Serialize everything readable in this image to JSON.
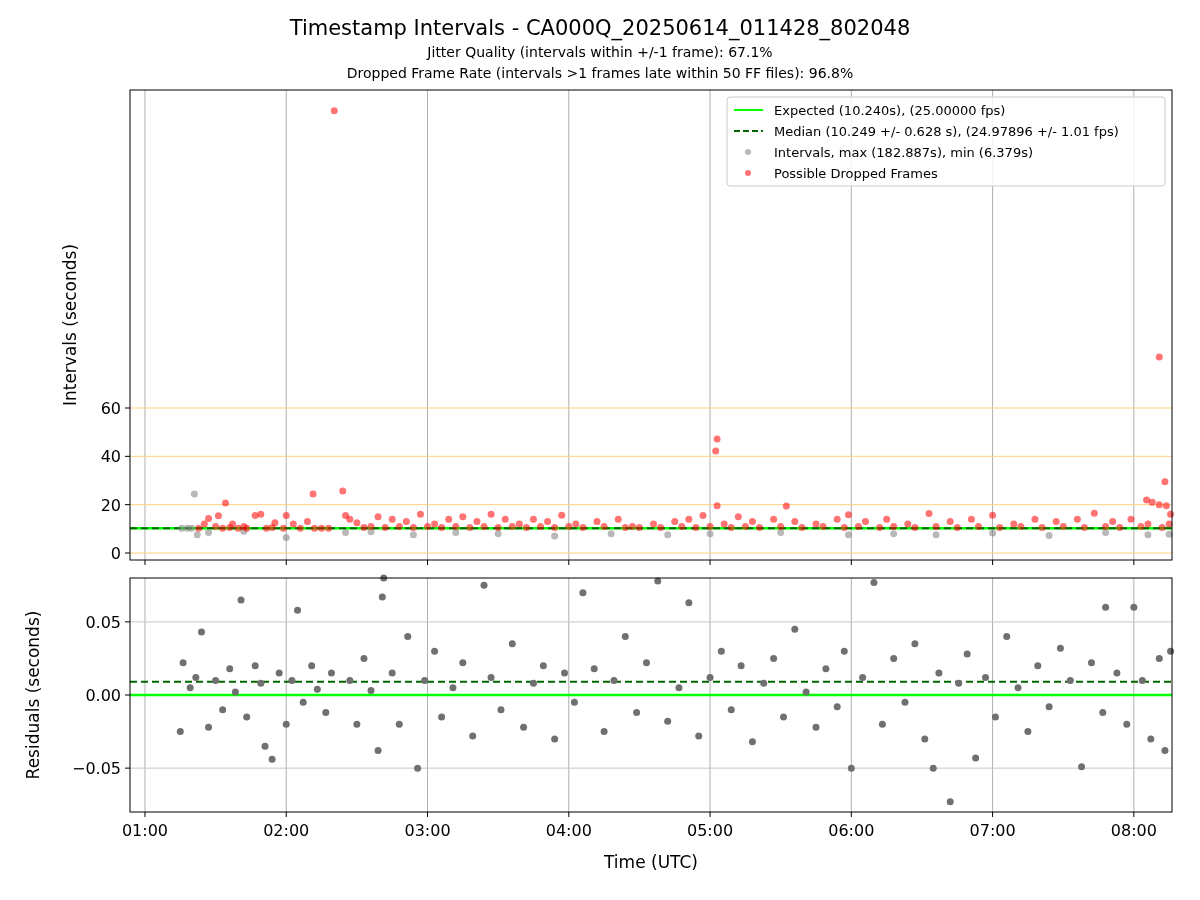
{
  "figure": {
    "title": "Timestamp Intervals - CA000Q_20250614_011428_802048",
    "subtitles": [
      "Jitter Quality (intervals within +/-1 frame): 67.1%",
      "Dropped Frame Rate (intervals >1 frames late within 50 FF files): 96.8%"
    ]
  },
  "intervals_plot": {
    "chart_data": {
      "type": "scatter",
      "ylabel": "Intervals (seconds)",
      "xlim": [
        0.894,
        8.27
      ],
      "ylim": [
        -2.9,
        191.6
      ],
      "grid": true,
      "yticks": [
        {
          "value": 0,
          "label": "0"
        },
        {
          "value": 20,
          "label": "20"
        },
        {
          "value": 40,
          "label": "40"
        },
        {
          "value": 60,
          "label": "60"
        }
      ],
      "legend": true,
      "series": [
        {
          "name": "Expected (10.240s), (25.00000 fps)",
          "type": "line",
          "line_style": "solid",
          "color": "#00ff00",
          "x": [
            0.894,
            8.27
          ],
          "values": [
            10.24,
            10.24
          ]
        },
        {
          "name": "Median (10.249 +/- 0.628 s), (24.97896 +/- 1.01 fps)",
          "type": "line",
          "line_style": "dashed",
          "color": "#006400",
          "x": [
            0.894,
            8.27
          ],
          "values": [
            10.25,
            10.25
          ]
        },
        {
          "name": "Intervals, max (182.887s), min (6.379s)",
          "color": "#808080",
          "x": [
            1.26,
            1.3,
            1.33,
            1.35,
            1.37,
            1.45,
            1.7,
            2.0,
            2.42,
            2.6,
            2.9,
            3.2,
            3.5,
            3.9,
            4.3,
            4.7,
            5.0,
            5.5,
            5.98,
            6.3,
            6.6,
            7.0,
            7.4,
            7.8,
            8.1,
            8.25
          ],
          "values": [
            10.2,
            10.2,
            10.2,
            24.4,
            7.5,
            8.5,
            9,
            6.4,
            8.5,
            8.8,
            7.5,
            8.5,
            8,
            7,
            8,
            7.5,
            8,
            8.5,
            7.5,
            8,
            7.5,
            8.3,
            7.2,
            8.5,
            7.5,
            7.8
          ]
        },
        {
          "name": "Possible Dropped Frames",
          "color": "#ff0000",
          "x": [
            2.34,
            8.18,
            5.05,
            5.04,
            5.05,
            5.54,
            2.4,
            2.19,
            1.57,
            8.09,
            8.13,
            8.18,
            8.23,
            8.22,
            8.26,
            1.38,
            1.42,
            1.45,
            1.5,
            1.52,
            1.55,
            1.6,
            1.62,
            1.66,
            1.7,
            1.72,
            1.78,
            1.82,
            1.86,
            1.9,
            1.92,
            1.98,
            2.0,
            2.05,
            2.1,
            2.15,
            2.2,
            2.25,
            2.3,
            2.42,
            2.45,
            2.5,
            2.55,
            2.6,
            2.65,
            2.7,
            2.75,
            2.8,
            2.85,
            2.9,
            2.95,
            3.0,
            3.05,
            3.1,
            3.15,
            3.2,
            3.25,
            3.3,
            3.35,
            3.4,
            3.45,
            3.5,
            3.55,
            3.6,
            3.65,
            3.7,
            3.75,
            3.8,
            3.85,
            3.9,
            3.95,
            4.0,
            4.05,
            4.1,
            4.2,
            4.25,
            4.35,
            4.4,
            4.45,
            4.5,
            4.6,
            4.65,
            4.75,
            4.8,
            4.85,
            4.9,
            4.95,
            5.0,
            5.1,
            5.15,
            5.2,
            5.25,
            5.3,
            5.35,
            5.45,
            5.5,
            5.6,
            5.65,
            5.75,
            5.8,
            5.9,
            5.95,
            5.98,
            6.05,
            6.1,
            6.2,
            6.25,
            6.3,
            6.4,
            6.45,
            6.55,
            6.6,
            6.7,
            6.75,
            6.85,
            6.9,
            7.0,
            7.05,
            7.15,
            7.2,
            7.3,
            7.35,
            7.45,
            7.5,
            7.6,
            7.65,
            7.72,
            7.8,
            7.85,
            7.9,
            7.98,
            8.05,
            8.1,
            8.2,
            8.25
          ],
          "values": [
            183,
            81.1,
            47.2,
            42.2,
            19.6,
            19.4,
            25.7,
            24.4,
            20.7,
            21.9,
            21,
            20,
            19.6,
            29.5,
            16,
            10.2,
            12,
            14.3,
            11,
            15.4,
            10.2,
            10.5,
            12,
            10.2,
            11,
            10.2,
            15.5,
            16,
            10.2,
            10.5,
            12.5,
            10.2,
            15.5,
            12,
            10.2,
            13,
            10.2,
            10.2,
            10.2,
            15.5,
            14,
            12.5,
            10.5,
            11,
            15,
            10.5,
            14,
            11,
            13,
            10.5,
            16,
            11,
            12,
            10.5,
            14,
            11,
            15,
            10.5,
            13,
            11,
            16,
            10.5,
            14,
            11,
            12,
            10.5,
            14,
            11,
            13,
            10.5,
            15.6,
            11,
            12,
            10.5,
            13,
            11,
            14,
            10.5,
            11,
            10.5,
            12,
            10.5,
            13,
            11,
            14,
            10.5,
            15.5,
            11,
            12,
            10.5,
            15,
            11,
            13,
            10.5,
            14,
            11,
            13,
            10.5,
            12,
            11,
            14,
            10.5,
            15.8,
            11,
            13,
            10.5,
            14,
            11,
            12,
            10.5,
            16.3,
            11,
            13,
            10.5,
            14,
            11,
            15.6,
            10.5,
            12,
            11,
            14,
            10.5,
            13,
            11,
            14,
            10.5,
            16.4,
            11,
            13,
            10.5,
            14,
            11,
            12,
            10.5,
            12
          ]
        }
      ]
    }
  },
  "residuals_plot": {
    "chart_data": {
      "type": "scatter",
      "xlabel": "Time (UTC)",
      "ylabel": "Residuals (seconds)",
      "xlim": [
        0.894,
        8.27
      ],
      "ylim": [
        -0.08,
        0.08
      ],
      "xticks": [
        {
          "value": 1,
          "label": "01:00"
        },
        {
          "value": 2,
          "label": "02:00"
        },
        {
          "value": 3,
          "label": "03:00"
        },
        {
          "value": 4,
          "label": "04:00"
        },
        {
          "value": 5,
          "label": "05:00"
        },
        {
          "value": 6,
          "label": "06:00"
        },
        {
          "value": 7,
          "label": "07:00"
        },
        {
          "value": 8,
          "label": "08:00"
        }
      ],
      "yticks": [
        {
          "value": -0.05,
          "label": "−0.05"
        },
        {
          "value": 0,
          "label": "0.00"
        },
        {
          "value": 0.05,
          "label": "0.05"
        }
      ],
      "grid": true,
      "series": [
        {
          "type": "line",
          "line_style": "solid",
          "color": "#00ff00",
          "x": [
            0.894,
            8.27
          ],
          "values": [
            0,
            0
          ]
        },
        {
          "type": "line",
          "line_style": "dashed",
          "color": "#006400",
          "x": [
            0.894,
            8.27
          ],
          "values": [
            0.009,
            0.009
          ]
        },
        {
          "color": "#707070",
          "x": [
            1.25,
            1.27,
            1.32,
            1.36,
            1.4,
            1.45,
            1.5,
            1.55,
            1.6,
            1.64,
            1.68,
            1.72,
            1.78,
            1.82,
            1.85,
            1.9,
            1.95,
            2.0,
            2.04,
            2.08,
            2.12,
            2.18,
            2.22,
            2.28,
            2.32,
            2.45,
            2.5,
            2.55,
            2.6,
            2.65,
            2.68,
            2.69,
            2.75,
            2.8,
            2.86,
            2.93,
            2.98,
            3.05,
            3.1,
            3.18,
            3.25,
            3.32,
            3.4,
            3.45,
            3.52,
            3.6,
            3.68,
            3.75,
            3.82,
            3.9,
            3.97,
            4.04,
            4.1,
            4.18,
            4.25,
            4.32,
            4.4,
            4.48,
            4.55,
            4.63,
            4.7,
            4.78,
            4.85,
            4.92,
            5.0,
            5.08,
            5.15,
            5.22,
            5.3,
            5.38,
            5.45,
            5.52,
            5.6,
            5.68,
            5.75,
            5.82,
            5.9,
            5.95,
            6.0,
            6.08,
            6.16,
            6.22,
            6.3,
            6.38,
            6.45,
            6.52,
            6.58,
            6.62,
            6.7,
            6.76,
            6.82,
            6.88,
            6.95,
            7.02,
            7.1,
            7.18,
            7.25,
            7.32,
            7.4,
            7.48,
            7.55,
            7.63,
            7.7,
            7.78,
            7.8,
            7.88,
            7.95,
            8.0,
            8.06,
            8.12,
            8.18,
            8.22,
            8.26
          ],
          "values": [
            -0.025,
            0.022,
            0.005,
            0.012,
            0.043,
            -0.022,
            0.01,
            -0.01,
            0.018,
            0.002,
            0.065,
            -0.015,
            0.02,
            0.008,
            -0.035,
            -0.044,
            0.015,
            -0.02,
            0.01,
            0.058,
            -0.005,
            0.02,
            0.004,
            -0.012,
            0.015,
            0.01,
            -0.02,
            0.025,
            0.003,
            -0.038,
            0.067,
            0.08,
            0.015,
            -0.02,
            0.04,
            -0.05,
            0.01,
            0.03,
            -0.015,
            0.005,
            0.022,
            -0.028,
            0.075,
            0.012,
            -0.01,
            0.035,
            -0.022,
            0.008,
            0.02,
            -0.03,
            0.015,
            -0.005,
            0.07,
            0.018,
            -0.025,
            0.01,
            0.04,
            -0.012,
            0.022,
            0.078,
            -0.018,
            0.005,
            0.063,
            -0.028,
            0.012,
            0.03,
            -0.01,
            0.02,
            -0.032,
            0.008,
            0.025,
            -0.015,
            0.045,
            0.002,
            -0.022,
            0.018,
            -0.008,
            0.03,
            -0.05,
            0.012,
            0.077,
            -0.02,
            0.025,
            -0.005,
            0.035,
            -0.03,
            -0.05,
            0.015,
            -0.073,
            0.008,
            0.028,
            -0.043,
            0.012,
            -0.015,
            0.04,
            0.005,
            -0.025,
            0.02,
            -0.008,
            0.032,
            0.01,
            -0.049,
            0.022,
            -0.012,
            0.06,
            0.015,
            -0.02,
            0.06,
            0.01,
            -0.03,
            0.025,
            -0.038,
            0.03
          ]
        }
      ]
    }
  }
}
